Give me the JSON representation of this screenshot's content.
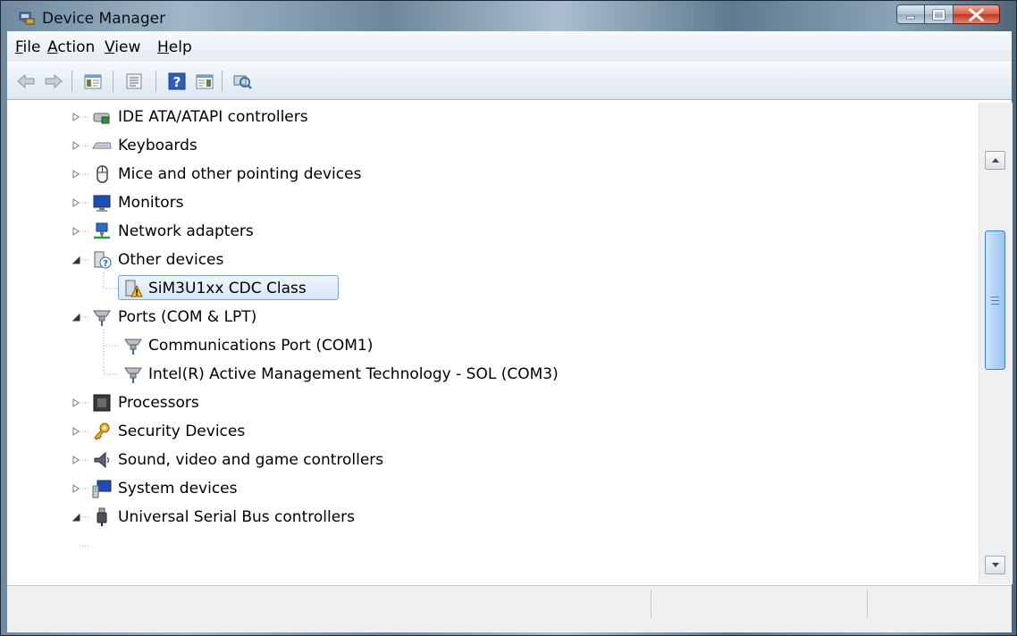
{
  "window": {
    "title": "Device Manager",
    "icons": {
      "app": "device-manager-icon",
      "minimize": "minimize-icon",
      "maximize": "maximize-icon",
      "close": "close-icon"
    }
  },
  "menu": {
    "items": [
      {
        "label": "File",
        "accel": "F",
        "rest": "ile"
      },
      {
        "label": "Action",
        "accel": "A",
        "rest": "ction"
      },
      {
        "label": "View",
        "accel": "V",
        "rest": "iew"
      },
      {
        "label": "Help",
        "accel": "H",
        "rest": "elp"
      }
    ]
  },
  "toolbar": {
    "buttons": [
      "back-arrow-icon",
      "forward-arrow-icon",
      "show-hide-console-tree-icon",
      "properties-icon",
      "help-icon",
      "action-pane-icon",
      "scan-hardware-icon"
    ]
  },
  "tree": {
    "items": [
      {
        "label": "IDE ATA/ATAPI controllers",
        "level": 0,
        "expanded": false,
        "icon": "ide-controller-icon"
      },
      {
        "label": "Keyboards",
        "level": 0,
        "expanded": false,
        "icon": "keyboard-icon"
      },
      {
        "label": "Mice and other pointing devices",
        "level": 0,
        "expanded": false,
        "icon": "mouse-icon"
      },
      {
        "label": "Monitors",
        "level": 0,
        "expanded": false,
        "icon": "monitor-icon"
      },
      {
        "label": "Network adapters",
        "level": 0,
        "expanded": false,
        "icon": "network-adapter-icon"
      },
      {
        "label": "Other devices",
        "level": 0,
        "expanded": true,
        "icon": "unknown-device-icon"
      },
      {
        "label": "SiM3U1xx CDC Class",
        "level": 1,
        "selected": true,
        "icon": "warning-device-icon"
      },
      {
        "label": "Ports (COM & LPT)",
        "level": 0,
        "expanded": true,
        "icon": "port-icon"
      },
      {
        "label": "Communications Port (COM1)",
        "level": 1,
        "icon": "port-icon"
      },
      {
        "label": "Intel(R) Active Management Technology - SOL (COM3)",
        "level": 1,
        "icon": "port-icon"
      },
      {
        "label": "Processors",
        "level": 0,
        "expanded": false,
        "icon": "processor-icon"
      },
      {
        "label": "Security Devices",
        "level": 0,
        "expanded": false,
        "icon": "security-key-icon"
      },
      {
        "label": "Sound, video and game controllers",
        "level": 0,
        "expanded": false,
        "icon": "speaker-icon"
      },
      {
        "label": "System devices",
        "level": 0,
        "expanded": false,
        "icon": "system-device-icon"
      },
      {
        "label": "Universal Serial Bus controllers",
        "level": 0,
        "expanded": true,
        "icon": "usb-icon"
      }
    ]
  },
  "scrollbar": {
    "icons": {
      "up": "scroll-up-arrow-icon",
      "down": "scroll-down-arrow-icon",
      "thumb": "scroll-thumb"
    }
  },
  "colors": {
    "selection_border": "#7da2ce",
    "selection_fill": "#d5e5f8",
    "titlebar_accent": "#c3361d",
    "tree_line": "#a0a0a0"
  }
}
